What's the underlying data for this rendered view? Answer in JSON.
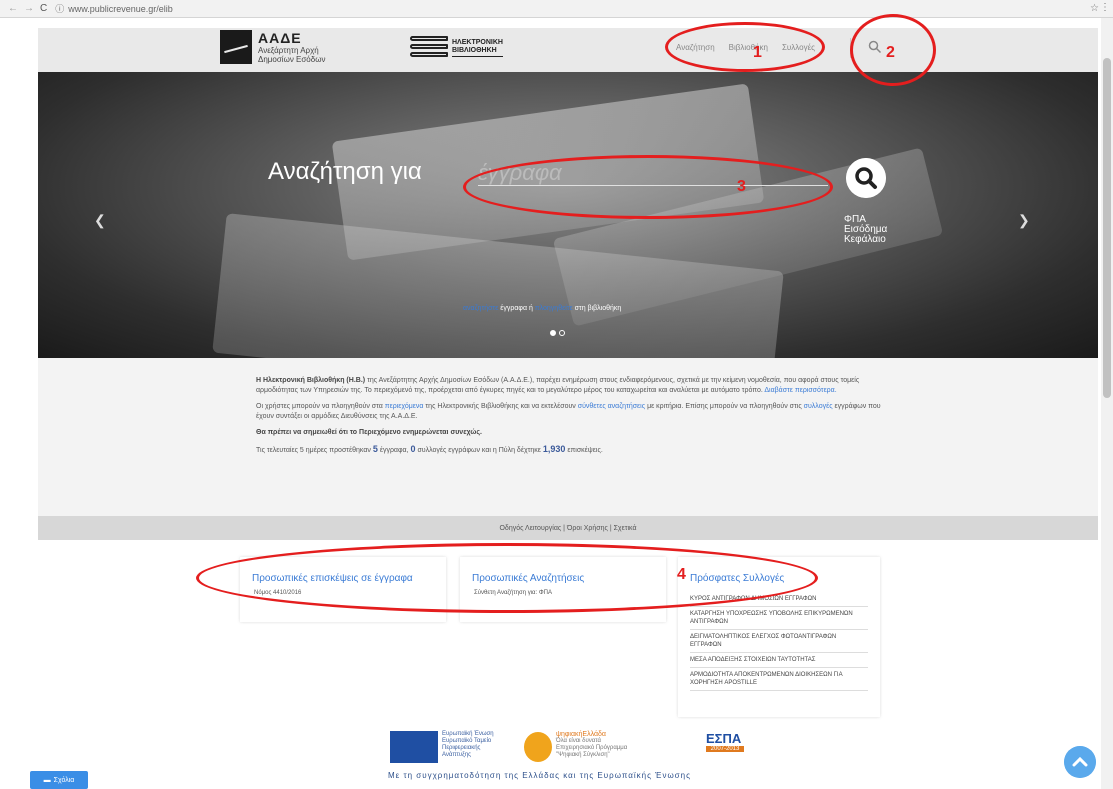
{
  "browser": {
    "url": "www.publicrevenue.gr/elib"
  },
  "header": {
    "org_title": "ΑΑΔΕ",
    "org_subtitle_line1": "Ανεξάρτητη Αρχή",
    "org_subtitle_line2": "Δημοσίων Εσόδων",
    "elib_line1": "ΗΛΕΚΤΡΟΝΙΚΗ",
    "elib_line2": "ΒΙΒΛΙΟΘΗΚΗ",
    "nav": [
      "Αναζήτηση",
      "Βιβλιοθήκη",
      "Συλλογές"
    ]
  },
  "hero": {
    "title": "Αναζήτηση για",
    "search_placeholder": "έγγραφα",
    "tags": [
      "ΦΠΑ",
      "Εισόδημα",
      "Κεφάλαιο"
    ],
    "caption_link1": "αναζητήστε",
    "caption_mid": "έγγραφα ή",
    "caption_link2": "πλοηγηθείτε",
    "caption_end": "στη βιβλιοθήκη"
  },
  "info": {
    "p1_bold": "Η Ηλεκτρονική Βιβλιοθήκη (Η.Β.)",
    "p1_text": "της Ανεξάρτητης Αρχής Δημοσίων Εσόδων (Α.Α.Δ.Ε.), παρέχει ενημέρωση στους ενδιαφερόμενους, σχετικά με την κείμενη νομοθεσία, που αφορά στους τομείς αρμοδιότητας των Υπηρεσιών της. Το περιεχόμενό της, προέρχεται από έγκυρες πηγές και το μεγαλύτερο μέρος του καταχωρείται και αναλύεται με αυτόματο τρόπο.",
    "p1_link": "Διαβάστε περισσότερα.",
    "p2_a": "Οι χρήστες μπορούν να πλοηγηθούν στα",
    "p2_link1": "περιεχόμενα",
    "p2_b": "της Ηλεκτρονικής Βιβλιοθήκης και να εκτελέσουν",
    "p2_link2": "σύνθετες αναζητήσεις",
    "p2_c": "με κριτήρια. Επίσης μπορούν να πλοηγηθούν στις",
    "p2_link3": "συλλογές",
    "p2_d": "εγγράφων που έχουν συντάξει οι αρμόδιες Διευθύνσεις της Α.Α.Δ.Ε.",
    "p3_bold": "Θα πρέπει να σημειωθεί ότι το Περιεχόμενο ενημερώνεται συνεχώς.",
    "p4_a": "Τις τελευταίες 5 ημέρες προστέθηκαν",
    "p4_docs": "5",
    "p4_b": "έγγραφα,",
    "p4_colls": "0",
    "p4_c": "συλλογές εγγράφων και η Πύλη δέχτηκε",
    "p4_visits": "1,930",
    "p4_d": "επισκέψεις."
  },
  "footer_links": "Οδηγός Λειτουργίας | Όροι Χρήσης | Σχετικά",
  "cards": {
    "visits_title": "Προσωπικές επισκέψεις σε έγγραφα",
    "visits_item": "Νόμος 4410/2016",
    "searches_title": "Προσωπικές Αναζητήσεις",
    "searches_item": "Σύνθετη Αναζήτηση για: ΦΠΑ",
    "recent_title": "Πρόσφατες Συλλογές",
    "recent_items": [
      "ΚΥΡΟΣ ΑΝΤΙΓΡΑΦΩΝ ΔΗΜΟΣΙΩΝ ΕΓΓΡΑΦΩΝ",
      "ΚΑΤΑΡΓΗΣΗ ΥΠΟΧΡΕΩΣΗΣ ΥΠΟΒΟΛΗΣ ΕΠΙΚΥΡΩΜΕΝΩΝ ΑΝΤΙΓΡΑΦΩΝ",
      "ΔΕΙΓΜΑΤΟΛΗΠΤΙΚΟΣ ΕΛΕΓΧΟΣ ΦΩΤΟΑΝΤΙΓΡΑΦΩΝ ΕΓΓΡΑΦΩΝ",
      "ΜΕΣΑ ΑΠΟΔΕΙΞΗΣ ΣΤΟΙΧΕΙΩΝ ΤΑΥΤΟΤΗΤΑΣ",
      "ΑΡΜΟΔΙΟΤΗΤΑ ΑΠΟΚΕΝΤΡΩΜΕΝΩΝ ΔΙΟΙΚΗΣΕΩΝ ΓΙΑ ΧΟΡΗΓΗΣΗ APOSTILLE"
    ]
  },
  "sponsors": {
    "eu_line1": "Ευρωπαϊκή Ένωση",
    "eu_line2": "Ευρωπαϊκό Ταμείο",
    "eu_line3": "Περιφερειακής",
    "eu_line4": "Ανάπτυξης",
    "digital_title": "ψηφιακήΕλλάδα",
    "digital_line1": "Όλα είναι δυνατά",
    "digital_line2": "Επιχειρησιακό Πρόγραμμα",
    "digital_line3": "\"Ψηφιακή Σύγκλιση\"",
    "espa_title": "ΕΣΠΑ",
    "espa_years": "2007-2013",
    "cofund": "Με τη συγχρηματοδότηση της Ελλάδας και της Ευρωπαϊκής Ένωσης"
  },
  "bottom": {
    "comments_label": "Σχόλια"
  },
  "annotations": [
    "1",
    "2",
    "3",
    "4"
  ],
  "colors": {
    "accent_link": "#3a7bd5",
    "annotation_red": "#e41e1e"
  }
}
